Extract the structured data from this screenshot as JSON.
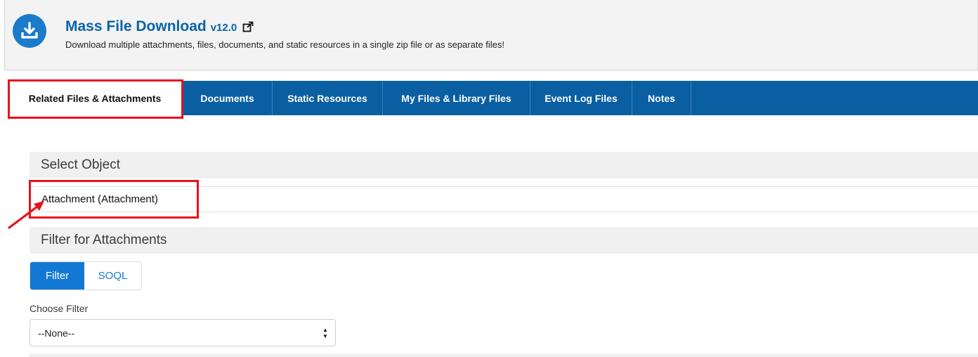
{
  "header": {
    "title": "Mass File Download",
    "version": "v12.0",
    "subtitle": "Download multiple attachments, files, documents, and static resources in a single zip file or as separate files!",
    "icon": "download-icon",
    "external_link_icon": "external-link-icon",
    "icon_color": "#1a7bcb",
    "title_color": "#0a64a8"
  },
  "tabs": [
    {
      "label": "Related Files & Attachments",
      "active": true
    },
    {
      "label": "Documents"
    },
    {
      "label": "Static Resources"
    },
    {
      "label": "My Files & Library Files"
    },
    {
      "label": "Event Log Files"
    },
    {
      "label": "Notes"
    }
  ],
  "tab_bar_color": "#0a5fa3",
  "annotation_color": "#e8121b",
  "select_object": {
    "heading": "Select Object",
    "selected": "Attachment (Attachment)"
  },
  "filter": {
    "heading": "Filter for Attachments",
    "mode_buttons": [
      {
        "label": "Filter",
        "active": true
      },
      {
        "label": "SOQL"
      }
    ],
    "choose_label": "Choose Filter",
    "choose_value": "--None--"
  }
}
